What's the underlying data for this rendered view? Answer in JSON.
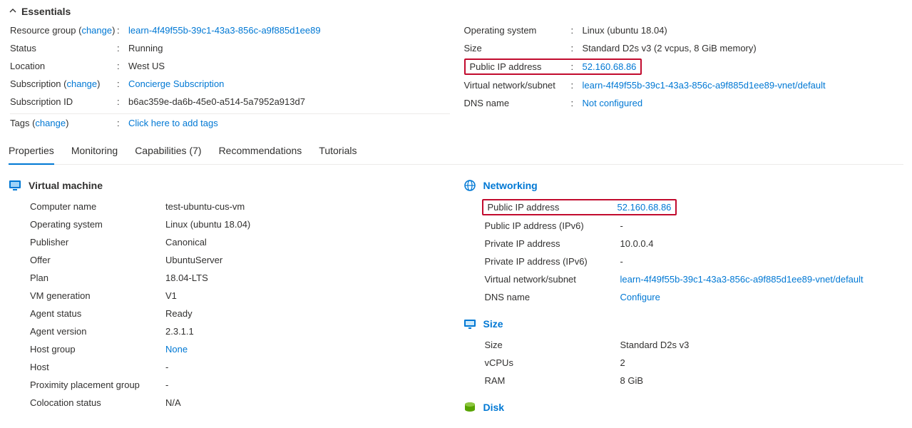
{
  "essentials": {
    "title": "Essentials",
    "left": [
      {
        "label_pre": "Resource group (",
        "change": "change",
        "label_post": ")",
        "value": "learn-4f49f55b-39c1-43a3-856c-a9f885d1ee89",
        "value_link": true
      },
      {
        "label": "Status",
        "value": "Running"
      },
      {
        "label": "Location",
        "value": "West US"
      },
      {
        "label_pre": "Subscription (",
        "change": "change",
        "label_post": ")",
        "value": "Concierge Subscription",
        "value_link": true
      },
      {
        "label": "Subscription ID",
        "value": "b6ac359e-da6b-45e0-a514-5a7952a913d7"
      },
      {
        "label_pre": "Tags (",
        "change": "change",
        "label_post": ")",
        "value": "Click here to add tags",
        "value_link": true
      }
    ],
    "right": [
      {
        "label": "Operating system",
        "value": "Linux (ubuntu 18.04)"
      },
      {
        "label": "Size",
        "value": "Standard D2s v3 (2 vcpus, 8 GiB memory)"
      },
      {
        "label": "Public IP address",
        "value": "52.160.68.86",
        "value_link": true,
        "highlight": true
      },
      {
        "label": "Virtual network/subnet",
        "value": "learn-4f49f55b-39c1-43a3-856c-a9f885d1ee89-vnet/default",
        "value_link": true
      },
      {
        "label": "DNS name",
        "value": "Not configured",
        "value_link": true
      }
    ]
  },
  "tabs": [
    {
      "label": "Properties"
    },
    {
      "label": "Monitoring"
    },
    {
      "label": "Capabilities (7)"
    },
    {
      "label": "Recommendations"
    },
    {
      "label": "Tutorials"
    }
  ],
  "vm": {
    "title": "Virtual machine",
    "icon_color": "#0078d4",
    "rows": [
      {
        "label": "Computer name",
        "value": "test-ubuntu-cus-vm"
      },
      {
        "label": "Operating system",
        "value": "Linux (ubuntu 18.04)"
      },
      {
        "label": "Publisher",
        "value": "Canonical"
      },
      {
        "label": "Offer",
        "value": "UbuntuServer"
      },
      {
        "label": "Plan",
        "value": "18.04-LTS"
      },
      {
        "label": "VM generation",
        "value": "V1"
      },
      {
        "label": "Agent status",
        "value": "Ready"
      },
      {
        "label": "Agent version",
        "value": "2.3.1.1"
      },
      {
        "label": "Host group",
        "value": "None",
        "value_link": true
      },
      {
        "label": "Host",
        "value": "-"
      },
      {
        "label": "Proximity placement group",
        "value": "-"
      },
      {
        "label": "Colocation status",
        "value": "N/A"
      }
    ]
  },
  "networking": {
    "title": "Networking",
    "title_link": true,
    "icon_color": "#0078d4",
    "rows": [
      {
        "label": "Public IP address",
        "value": "52.160.68.86",
        "value_link": true,
        "highlight": true
      },
      {
        "label": "Public IP address (IPv6)",
        "value": "-"
      },
      {
        "label": "Private IP address",
        "value": "10.0.0.4"
      },
      {
        "label": "Private IP address (IPv6)",
        "value": "-"
      },
      {
        "label": "Virtual network/subnet",
        "value": "learn-4f49f55b-39c1-43a3-856c-a9f885d1ee89-vnet/default",
        "value_link": true
      },
      {
        "label": "DNS name",
        "value": "Configure",
        "value_link": true
      }
    ]
  },
  "size": {
    "title": "Size",
    "title_link": true,
    "icon_color": "#0078d4",
    "rows": [
      {
        "label": "Size",
        "value": "Standard D2s v3"
      },
      {
        "label": "vCPUs",
        "value": "2"
      },
      {
        "label": "RAM",
        "value": "8 GiB"
      }
    ]
  },
  "disk": {
    "title": "Disk",
    "title_link": true
  }
}
